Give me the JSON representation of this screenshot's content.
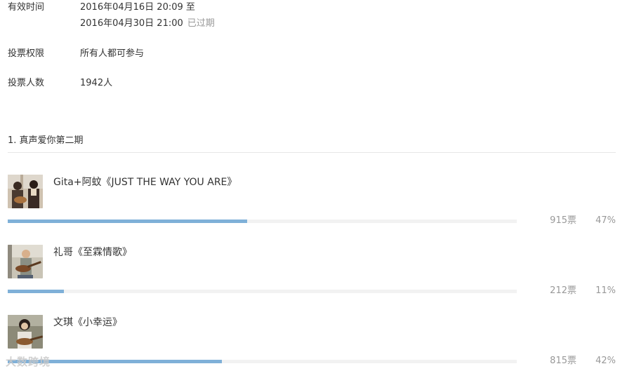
{
  "vote_info": {
    "time": {
      "label": "有效时间",
      "start": "2016年04月16日 20:09 至",
      "end": "2016年04月30日 21:00",
      "status": "已过期"
    },
    "permission": {
      "label": "投票权限",
      "value": "所有人都可参与"
    },
    "count": {
      "label": "投票人数",
      "value": "1942人"
    }
  },
  "question": {
    "title": "1. 真声爱你第二期",
    "options": [
      {
        "label": "Gita+阿蚊《JUST THE WAY YOU ARE》",
        "votes": "915票",
        "percent": "47%",
        "fraction": 0.47
      },
      {
        "label": "礼哥《至霖情歌》",
        "votes": "212票",
        "percent": "11%",
        "fraction": 0.11
      },
      {
        "label": "文琪《小幸运》",
        "votes": "815票",
        "percent": "42%",
        "fraction": 0.42
      }
    ]
  },
  "colors": {
    "bar_fill": "#7fb0d8",
    "bar_track": "#f2f2f2",
    "muted_text": "#999999"
  },
  "watermark": "大数跨境"
}
